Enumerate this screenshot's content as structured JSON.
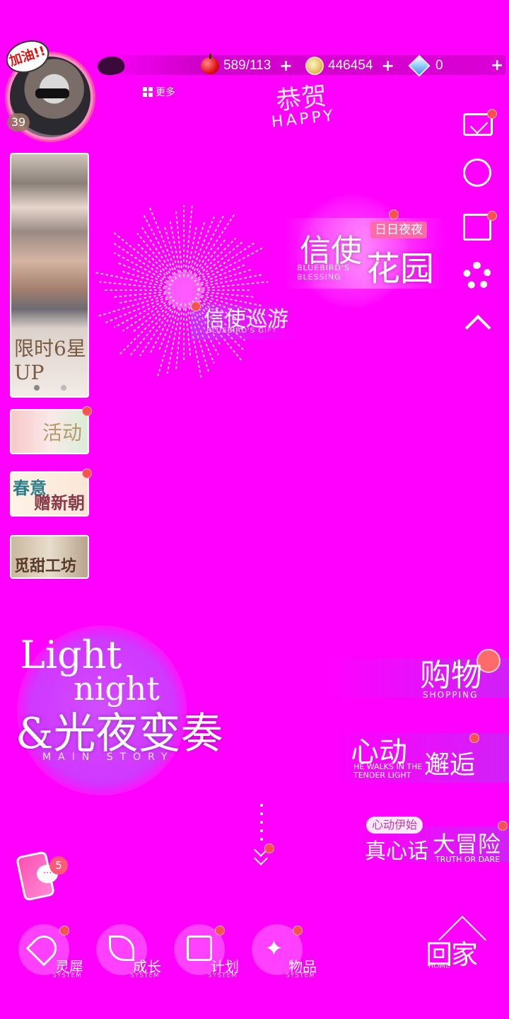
{
  "status_bar": {
    "stamina": "589/113",
    "stamina_plus": "+",
    "gold": "446454",
    "gold_plus": "+",
    "diamonds": "0",
    "diamonds_plus": "+"
  },
  "profile": {
    "level": "39",
    "badge": "加油!!",
    "more_label": "更多"
  },
  "banner": {
    "happy_zh": "恭贺",
    "happy_en": "HAPPY"
  },
  "left_events": {
    "limited_up": "限时6星UP",
    "activity": "活动",
    "spring_line1": "春意",
    "spring_line2": "赠新朝",
    "sweet_workshop": "觅甜工坊"
  },
  "features": {
    "garden_tag": "日日夜夜",
    "garden_title_1": "信使",
    "garden_title_2": "花园",
    "garden_en": "BLUEBIRD'S BLESSING",
    "tour_title": "信使巡游",
    "tour_en": "BLUEBIRD'S GIFT"
  },
  "main_story": {
    "light": "Light",
    "night": "night",
    "zh_title": "&光夜变奏",
    "en_sub": "MAIN STORY"
  },
  "right_menu": {
    "shopping_zh": "购物",
    "shopping_en": "SHOPPING",
    "heart_zh_1": "心动",
    "heart_zh_2": "邂逅",
    "heart_en": "HE WALKS IN THE TENDER LIGHT",
    "truth_tag": "心动伊始",
    "truth_zh_1": "真心话",
    "truth_zh_2": "大冒险",
    "truth_en": "TRUTH OR DARE"
  },
  "phone": {
    "unread": "5"
  },
  "bottom_nav": [
    {
      "label": "灵犀",
      "sub": "SYSTEM",
      "icon": "wings-icon"
    },
    {
      "label": "成长",
      "sub": "SYSTEM",
      "icon": "leaf-icon"
    },
    {
      "label": "计划",
      "sub": "SYSTEM",
      "icon": "calendar-icon"
    },
    {
      "label": "物品",
      "sub": "SYSTEM",
      "icon": "stars-icon"
    }
  ],
  "home": {
    "zh": "回家",
    "en": "HOME"
  },
  "colors": {
    "background": "#ff00ff",
    "notification_dot": "#ff5050",
    "accent_pink": "#ff6aa8"
  }
}
